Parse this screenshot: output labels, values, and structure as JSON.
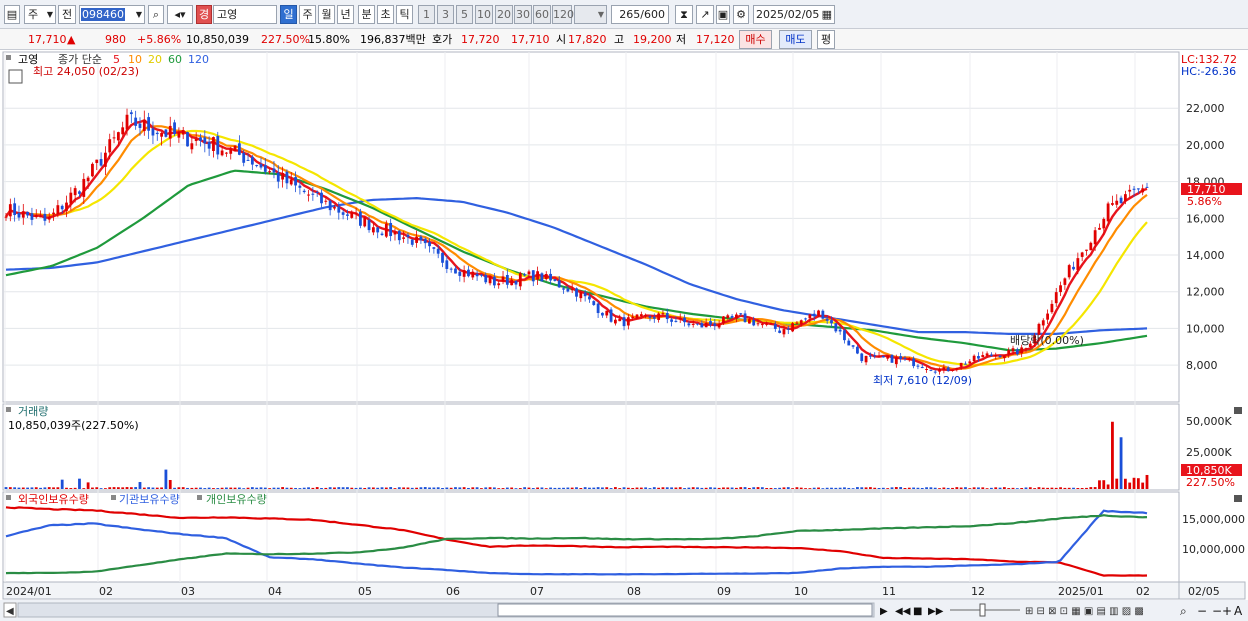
{
  "toolbar": {
    "market_select": "주",
    "type_select": "전",
    "stock_code": "098460",
    "badge": "경",
    "stock_name": "고영",
    "periods": [
      "일",
      "주",
      "월",
      "년",
      "분",
      "초",
      "틱"
    ],
    "active_period": "일",
    "intervals": [
      "1",
      "3",
      "5",
      "10",
      "20",
      "30",
      "60",
      "120"
    ],
    "count": "265",
    "count_total": "/600",
    "date": "2025/02/05"
  },
  "quote": {
    "price": "17,710",
    "arrow": "▲",
    "change": "980",
    "change_pct": "+5.86%",
    "volume": "10,850,039",
    "volume_ratio": "227.50%",
    "turnover": "15.80%",
    "amount": "196,837백만",
    "hoga_label": "호가",
    "ask": "17,720",
    "bid": "17,710",
    "open_label": "시",
    "open": "17,820",
    "high_label": "고",
    "high": "19,200",
    "low_label": "저",
    "low": "17,120",
    "buy_button": "매수",
    "sell_button": "매도",
    "eval_button": "평"
  },
  "price_panel": {
    "name": "고영",
    "ma_title": "종가 단순",
    "ma_periods": [
      "5",
      "10",
      "20",
      "60",
      "120"
    ],
    "ma_colors": [
      "#e8141c",
      "#ff8c00",
      "#f5e600",
      "#1f9a3c",
      "#3060e0"
    ],
    "lc": "LC:132.72",
    "hc": "HC:-26.36",
    "max_note": "최고 24,050 (02/23)",
    "min_note": "최저 7,610 (12/09)",
    "dividend_note": "배당락(0.00%)",
    "last_price_tag": "17,710",
    "last_pct_tag": "5.86%",
    "y_ticks": [
      "22,000",
      "20,000",
      "18,000",
      "16,000",
      "14,000",
      "12,000",
      "10,000",
      "8,000"
    ],
    "y_values": [
      22000,
      20000,
      18000,
      16000,
      14000,
      12000,
      10000,
      8000
    ]
  },
  "volume_panel": {
    "title": "거래량",
    "value_label": "10,850,039주(227.50%)",
    "y_ticks": [
      "50,000K",
      "25,000K"
    ],
    "last_tag": "10,850K",
    "last_pct": "227.50%"
  },
  "holding_panel": {
    "titles": [
      "외국인보유수량",
      "기관보유수량",
      "개인보유수량"
    ],
    "colors": [
      "#e00000",
      "#2f5fe0",
      "#2a8c44"
    ],
    "y_ticks": [
      "15,000,000",
      "10,000,000"
    ]
  },
  "x_axis": {
    "labels": [
      "2024/01",
      "02",
      "03",
      "04",
      "05",
      "06",
      "07",
      "08",
      "09",
      "10",
      "11",
      "12",
      "2025/01",
      "02",
      "02/05"
    ]
  },
  "chart_data": {
    "type": "candlestick",
    "price_points": [
      {
        "date": "2024/01",
        "close": 16500
      },
      {
        "date": "2024/01 mid",
        "close": 15800
      },
      {
        "date": "2024/02",
        "close": 18200
      },
      {
        "date": "2024/02 peak",
        "close": 21300
      },
      {
        "date": "2024/03",
        "close": 20600
      },
      {
        "date": "2024/03 mid",
        "close": 20100
      },
      {
        "date": "2024/04",
        "close": 19200
      },
      {
        "date": "2024/04 mid",
        "close": 17800
      },
      {
        "date": "2024/05",
        "close": 16600
      },
      {
        "date": "2024/05 mid",
        "close": 15600
      },
      {
        "date": "2024/06",
        "close": 14800
      },
      {
        "date": "2024/06 mid",
        "close": 13300
      },
      {
        "date": "2024/07",
        "close": 12500
      },
      {
        "date": "2024/07 mid",
        "close": 12900
      },
      {
        "date": "2024/08",
        "close": 12000
      },
      {
        "date": "2024/08 mid",
        "close": 10300
      },
      {
        "date": "2024/09",
        "close": 10700
      },
      {
        "date": "2024/09 mid",
        "close": 10100
      },
      {
        "date": "2024/10",
        "close": 10600
      },
      {
        "date": "2024/10 mid",
        "close": 9900
      },
      {
        "date": "2024/11",
        "close": 10900
      },
      {
        "date": "2024/11 mid",
        "close": 8400
      },
      {
        "date": "2024/12",
        "close": 8300
      },
      {
        "date": "2024/12 low",
        "close": 7700
      },
      {
        "date": "2025/01",
        "close": 8500
      },
      {
        "date": "2025/01 mid",
        "close": 8800
      },
      {
        "date": "2025/01 late",
        "close": 12800
      },
      {
        "date": "2025/02",
        "close": 16400
      },
      {
        "date": "2025/02/05",
        "close": 17710
      }
    ],
    "ma120_points": [
      13200,
      13300,
      13600,
      14200,
      14800,
      15400,
      16000,
      16600,
      17000,
      17100,
      16900,
      16300,
      15500,
      14500,
      13500,
      12400,
      11600,
      11000,
      10600,
      10200,
      9800,
      9800,
      9700,
      9700,
      9900,
      10000
    ],
    "ma60_points": [
      12900,
      13400,
      14400,
      16000,
      17800,
      18600,
      18400,
      17600,
      16600,
      15400,
      14200,
      13200,
      12400,
      11800,
      11200,
      10800,
      10500,
      10300,
      10100,
      9900,
      9500,
      9200,
      8800,
      8900,
      9200,
      9600
    ]
  }
}
